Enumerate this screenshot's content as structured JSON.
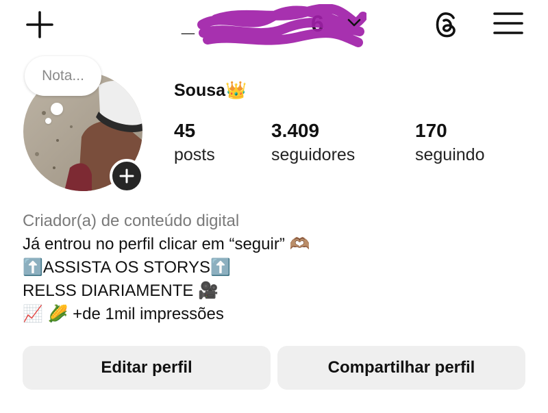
{
  "header": {
    "username_visible": "_",
    "username_tail": "6",
    "icons": [
      "plus-icon",
      "chevron-down-icon",
      "threads-icon",
      "menu-icon"
    ],
    "redaction_color": "#a020a8"
  },
  "profile": {
    "note_placeholder": "Nota...",
    "display_name": "Sousa",
    "display_name_emoji": "👑",
    "stats": [
      {
        "value": "45",
        "label": "posts"
      },
      {
        "value": "3.409",
        "label": "seguidores"
      },
      {
        "value": "170",
        "label": "seguindo"
      }
    ]
  },
  "bio": {
    "category": "Criador(a) de conteúdo digital",
    "line1": "Já entrou no perfil clicar em “seguir” 🫶🏽",
    "line2": "⬆️ASSISTA OS STORYS⬆️",
    "line3": "RELSS DIARIAMENTE 🎥",
    "line4": "📈 🌽 +de 1mil impressões"
  },
  "actions": {
    "edit_label": "Editar perfil",
    "share_label": "Compartilhar perfil"
  }
}
